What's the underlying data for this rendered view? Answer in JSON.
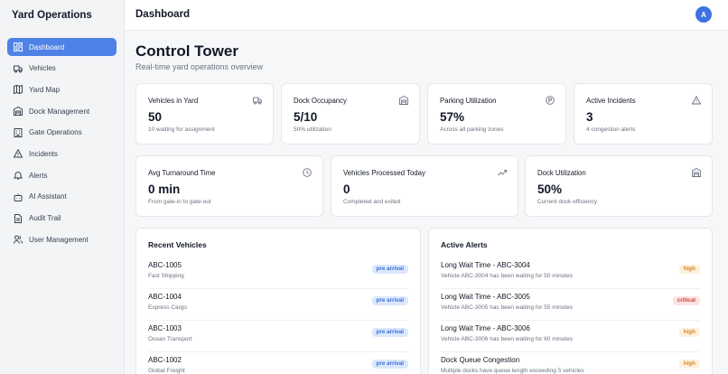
{
  "app": {
    "title": "Yard Operations"
  },
  "sidebar": {
    "items": [
      {
        "label": "Dashboard",
        "icon": "dashboard-icon",
        "active": true
      },
      {
        "label": "Vehicles",
        "icon": "truck-icon"
      },
      {
        "label": "Yard Map",
        "icon": "map-icon"
      },
      {
        "label": "Dock Management",
        "icon": "warehouse-icon"
      },
      {
        "label": "Gate Operations",
        "icon": "gate-icon"
      },
      {
        "label": "Incidents",
        "icon": "warning-icon"
      },
      {
        "label": "Alerts",
        "icon": "bell-icon"
      },
      {
        "label": "AI Assistant",
        "icon": "robot-icon"
      },
      {
        "label": "Audit Trail",
        "icon": "document-icon"
      },
      {
        "label": "User Management",
        "icon": "users-icon"
      }
    ]
  },
  "header": {
    "title": "Dashboard",
    "avatar": "A"
  },
  "page": {
    "title": "Control Tower",
    "subtitle": "Real-time yard operations overview"
  },
  "stats_row1": [
    {
      "label": "Vehicles in Yard",
      "value": "50",
      "desc": "10 waiting for assignment",
      "icon": "truck-icon"
    },
    {
      "label": "Dock Occupancy",
      "value": "5/10",
      "desc": "50% utilization",
      "icon": "warehouse-icon"
    },
    {
      "label": "Parking Utilization",
      "value": "57%",
      "desc": "Across all parking zones",
      "icon": "parking-icon"
    },
    {
      "label": "Active Incidents",
      "value": "3",
      "desc": "4 congestion alerts",
      "icon": "warning-icon"
    }
  ],
  "stats_row2": [
    {
      "label": "Avg Turnaround Time",
      "value": "0 min",
      "desc": "From gate-in to gate-out",
      "icon": "clock-icon"
    },
    {
      "label": "Vehicles Processed Today",
      "value": "0",
      "desc": "Completed and exited",
      "icon": "trending-up-icon"
    },
    {
      "label": "Dock Utilization",
      "value": "50%",
      "desc": "Current dock efficiency",
      "icon": "warehouse-icon"
    }
  ],
  "recent_vehicles": {
    "title": "Recent Vehicles",
    "rows": [
      {
        "id": "ABC-1005",
        "company": "Fast Shipping",
        "status": "pre arrival"
      },
      {
        "id": "ABC-1004",
        "company": "Express Cargo",
        "status": "pre arrival"
      },
      {
        "id": "ABC-1003",
        "company": "Ocean Transport",
        "status": "pre arrival"
      },
      {
        "id": "ABC-1002",
        "company": "Global Freight",
        "status": "pre arrival"
      }
    ]
  },
  "active_alerts": {
    "title": "Active Alerts",
    "rows": [
      {
        "title": "Long Wait Time - ABC-3004",
        "desc": "Vehicle ABC-3004 has been waiting for 50 minutes",
        "severity": "high"
      },
      {
        "title": "Long Wait Time - ABC-3005",
        "desc": "Vehicle ABC-3005 has been waiting for 55 minutes",
        "severity": "critical"
      },
      {
        "title": "Long Wait Time - ABC-3006",
        "desc": "Vehicle ABC-3006 has been waiting for 60 minutes",
        "severity": "high"
      },
      {
        "title": "Dock Queue Congestion",
        "desc": "Multiple docks have queue length exceeding 5 vehicles",
        "severity": "high"
      }
    ]
  }
}
